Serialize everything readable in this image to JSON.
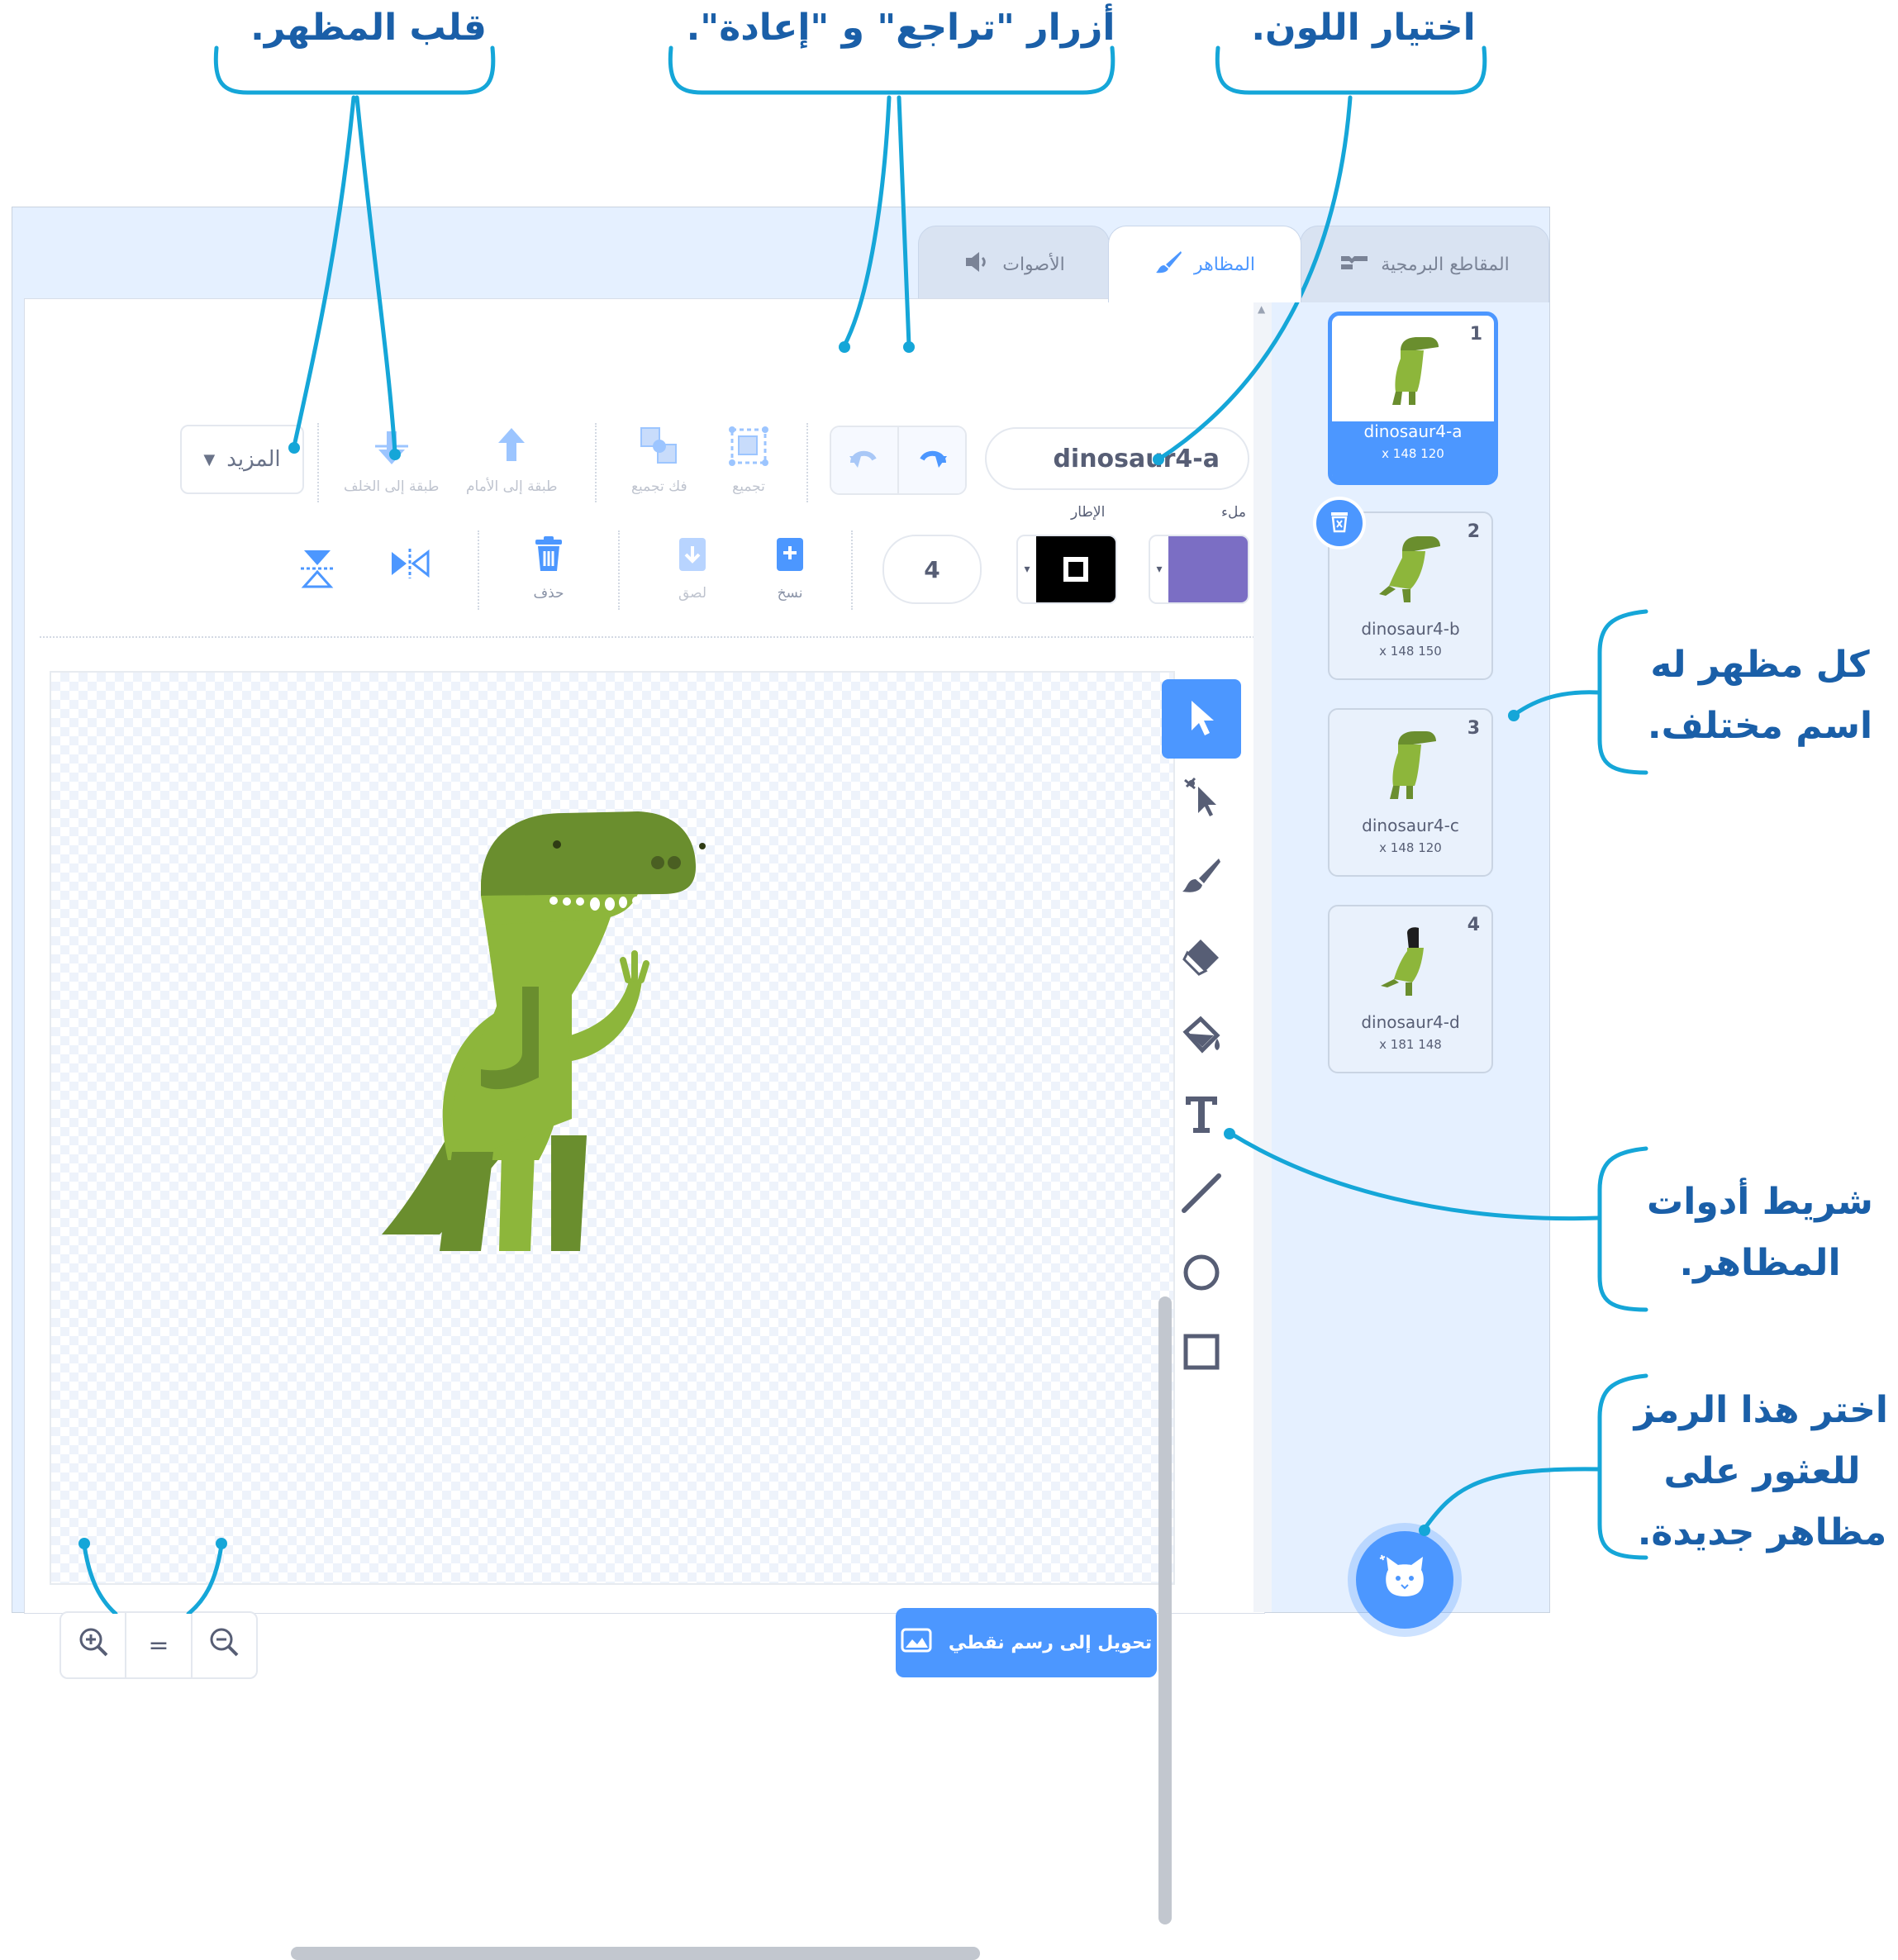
{
  "callouts": {
    "flip": "قلب المظهر.",
    "undo_redo": "أزرار \"تراجع\" و \"إعادة\".",
    "color": "اختيار اللون.",
    "names_line1": "كل مظهر له",
    "names_line2": "اسم مختلف.",
    "toolbar_line1": "شريط أدوات",
    "toolbar_line2": "المظاهر.",
    "choose_line1": "اختر هذا الرمز",
    "choose_line2": "للعثور على",
    "choose_line3": "مظاهر جديدة."
  },
  "tabs": {
    "code": "المقاطع البرمجية",
    "costumes": "المظاهر",
    "sounds": "الأصوات"
  },
  "toolbar": {
    "costume_name": "dinosaur4-a",
    "group": "تجميع",
    "ungroup": "فك تجميع",
    "forward": "طبقة إلى الأمام",
    "backward": "طبقة إلى الخلف",
    "more": "المزيد",
    "fill_label": "ملء",
    "outline_label": "الإطار",
    "outline_size": "4",
    "paste": "لصق",
    "copy": "نسخ",
    "delete": "حذف",
    "fill_color": "#7b6ec4",
    "outline_color": "#000000"
  },
  "canvas": {
    "convert_bitmap": "تحويل إلى رسم نقطي",
    "zoom_reset": "="
  },
  "tools": [
    "select-arrow-icon",
    "reshape-icon",
    "brush-icon",
    "eraser-icon",
    "fill-bucket-icon",
    "text-tool-icon",
    "line-tool-icon",
    "circle-tool-icon",
    "rectangle-tool-icon"
  ],
  "costumes": [
    {
      "number": "1",
      "name": "dinosaur4-a",
      "size": "x 148 120"
    },
    {
      "number": "2",
      "name": "dinosaur4-b",
      "size": "x 148 150"
    },
    {
      "number": "3",
      "name": "dinosaur4-c",
      "size": "x 148 120"
    },
    {
      "number": "4",
      "name": "dinosaur4-d",
      "size": "x 181 148"
    }
  ],
  "colors": {
    "accent": "#4c97ff",
    "callout_line": "#15a6d8",
    "callout_text": "#1a5fa8",
    "dino_light": "#8db63b",
    "dino_dark": "#6a8e2e"
  }
}
